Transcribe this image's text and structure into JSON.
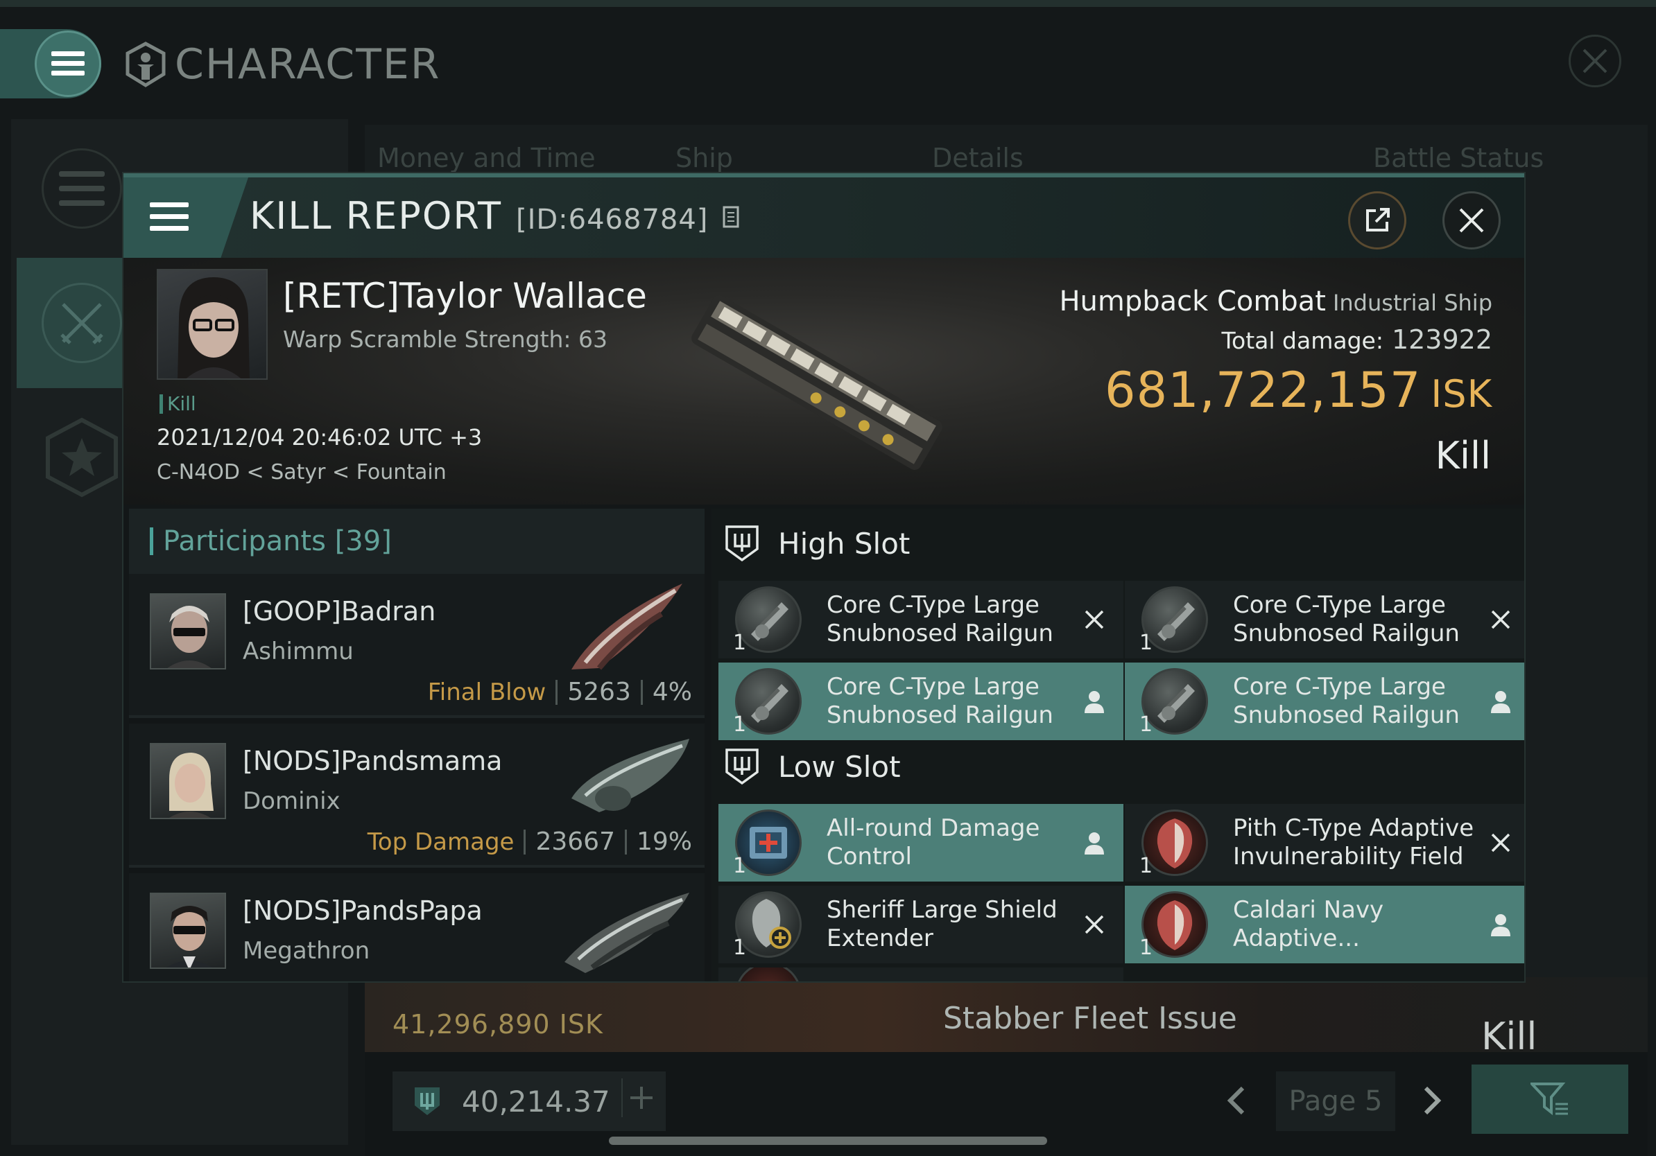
{
  "background": {
    "title": "CHARACTER",
    "tabs": [
      "Money and Time",
      "Ship",
      "Details",
      "Battle Status"
    ],
    "bottom_row": {
      "isk": "41,296,890  ISK",
      "ship": "Stabber Fleet Issue",
      "result": "Kill"
    },
    "wallet": "40,214.37",
    "page": "Page 5"
  },
  "modal": {
    "title": "KILL REPORT",
    "id": "[ID:6468784]",
    "victim": {
      "name": "[RETC]Taylor Wallace",
      "warp_scramble": "Warp Scramble Strength: 63",
      "tag": "Kill",
      "datetime": "2021/12/04 20:46:02 UTC +3",
      "location": "C-N4OD < Satyr < Fountain",
      "ship": "Humpback Combat",
      "ship_class": "Industrial Ship",
      "total_damage_label": "Total damage:",
      "total_damage": "123922",
      "isk_value": "681,722,157",
      "isk_unit": "ISK",
      "result": "Kill"
    },
    "participants": {
      "title": "Participants",
      "count": "[39]",
      "rows": [
        {
          "name": "[GOOP]Badran",
          "ship": "Ashimmu",
          "label": "Final Blow",
          "damage": "5263",
          "percent": "4%"
        },
        {
          "name": "[NODS]Pandsmama",
          "ship": "Dominix",
          "label": "Top Damage",
          "damage": "23667",
          "percent": "19%"
        },
        {
          "name": "[NODS]PandsPapa",
          "ship": "Megathron",
          "label": "",
          "damage": "",
          "percent": ""
        }
      ]
    },
    "high_slot": {
      "title": "High Slot",
      "modules": [
        {
          "name": "Core C-Type Large Snubnosed Railgun",
          "qty": "1",
          "state": "destroyed"
        },
        {
          "name": "Core C-Type Large Snubnosed Railgun",
          "qty": "1",
          "state": "destroyed"
        },
        {
          "name": "Core C-Type Large Snubnosed Railgun",
          "qty": "1",
          "state": "dropped"
        },
        {
          "name": "Core C-Type Large Snubnosed Railgun",
          "qty": "1",
          "state": "dropped"
        }
      ]
    },
    "low_slot": {
      "title": "Low Slot",
      "modules": [
        {
          "name": "All-round Damage Control",
          "qty": "1",
          "state": "dropped"
        },
        {
          "name": "Pith C-Type Adaptive Invulnerability Field",
          "qty": "1",
          "state": "destroyed"
        },
        {
          "name": "Sheriff Large Shield Extender",
          "qty": "1",
          "state": "destroyed"
        },
        {
          "name": "Caldari Navy Adaptive...",
          "qty": "1",
          "state": "dropped"
        }
      ]
    },
    "colors": {
      "accent": "#4c7f78",
      "isk": "#e7b45a",
      "label_gold": "#c59a48",
      "teal": "#62a39a"
    }
  }
}
